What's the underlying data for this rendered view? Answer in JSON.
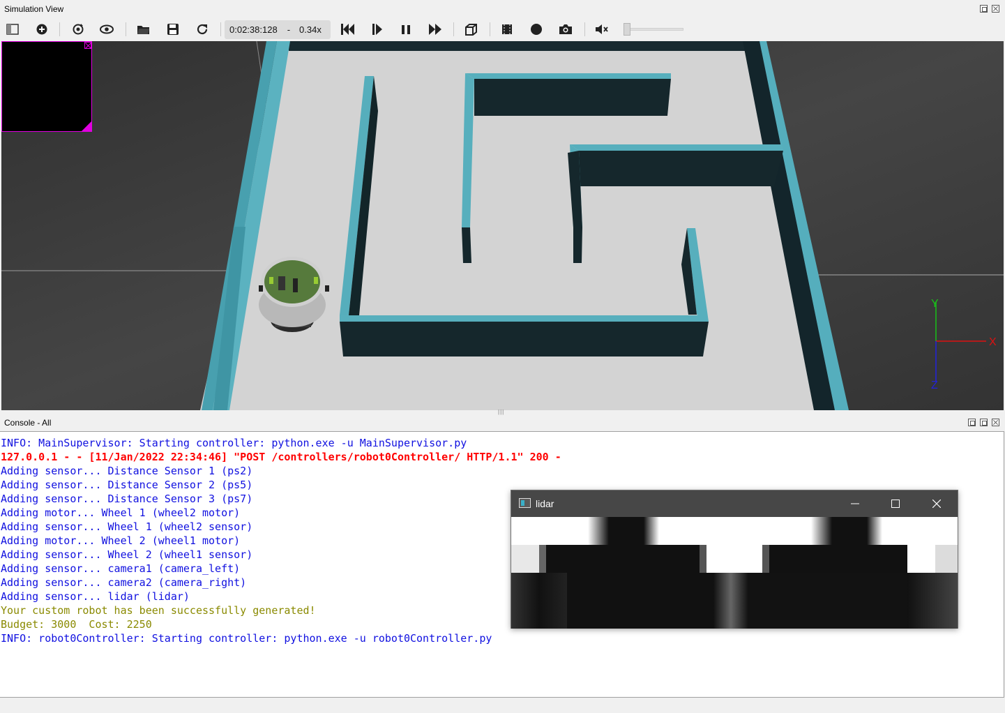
{
  "simulation_view": {
    "title": "Simulation View",
    "toolbar": {
      "icons": [
        "scene-tree-toggle-icon",
        "add-object-icon",
        "reload-world-icon",
        "view-options-icon",
        "open-world-icon",
        "save-world-icon",
        "reset-simulation-icon",
        "step-back-icon",
        "step-icon",
        "pause-icon",
        "fast-forward-icon",
        "rendering-toggle-icon",
        "record-movie-icon",
        "record-animation-icon",
        "screenshot-icon",
        "mute-icon"
      ],
      "time": "0:02:38:128",
      "separator": "-",
      "speed": "0.34x",
      "volume_fraction": 0.0
    },
    "axes": {
      "x": "X",
      "y": "Y",
      "z": "Z"
    },
    "colors": {
      "wall_top": "#4fa8b7",
      "wall_side": "#13262b",
      "floor": "#d4d4d4",
      "background": "#3a3a3a",
      "camera_overlay_border": "#e000e0"
    }
  },
  "console": {
    "title": "Console - All",
    "lines": [
      {
        "text": "INFO: MainSupervisor: Starting controller: python.exe -u MainSupervisor.py",
        "style": "blue"
      },
      {
        "text": "127.0.0.1 - - [11/Jan/2022 22:34:46] \"POST /controllers/robot0Controller/ HTTP/1.1\" 200 -",
        "style": "red"
      },
      {
        "text": "Adding sensor... Distance Sensor 1 (ps2)",
        "style": "blue"
      },
      {
        "text": "Adding sensor... Distance Sensor 2 (ps5)",
        "style": "blue"
      },
      {
        "text": "Adding sensor... Distance Sensor 3 (ps7)",
        "style": "blue"
      },
      {
        "text": "Adding motor... Wheel 1 (wheel2 motor)",
        "style": "blue"
      },
      {
        "text": "Adding sensor... Wheel 1 (wheel2 sensor)",
        "style": "blue"
      },
      {
        "text": "Adding motor... Wheel 2 (wheel1 motor)",
        "style": "blue"
      },
      {
        "text": "Adding sensor... Wheel 2 (wheel1 sensor)",
        "style": "blue"
      },
      {
        "text": "Adding sensor... camera1 (camera_left)",
        "style": "blue"
      },
      {
        "text": "Adding sensor... camera2 (camera_right)",
        "style": "blue"
      },
      {
        "text": "Adding sensor... lidar (lidar)",
        "style": "blue"
      },
      {
        "text": "Your custom robot has been successfully generated!",
        "style": "olive"
      },
      {
        "text": "Budget: 3000  Cost: 2250",
        "style": "olive"
      },
      {
        "text": "INFO: robot0Controller: Starting controller: python.exe -u robot0Controller.py",
        "style": "blue"
      }
    ]
  },
  "lidar_window": {
    "title": "lidar",
    "buttons": [
      "minimize-icon",
      "maximize-icon",
      "close-icon"
    ]
  }
}
